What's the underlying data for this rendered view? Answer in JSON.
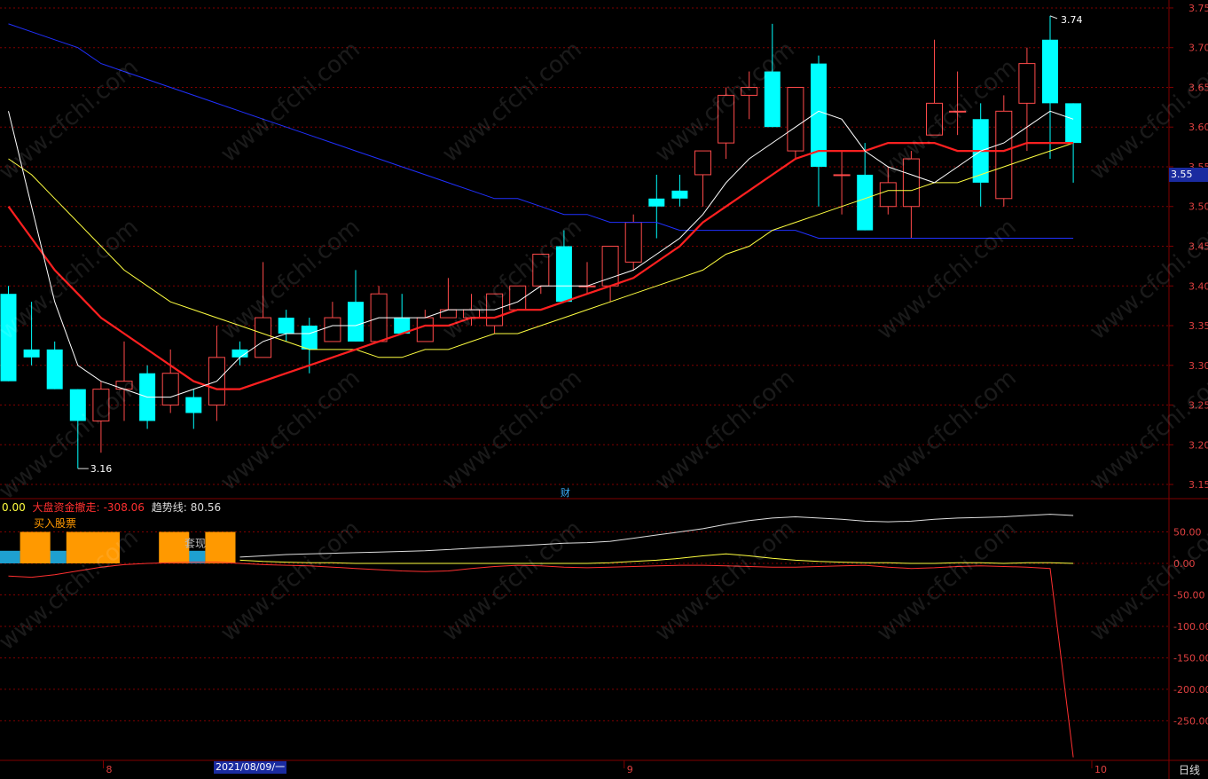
{
  "colors": {
    "up": "#ff4a4a",
    "down": "#00ffff",
    "ma5": "#ffffff",
    "ma10": "#ff2020",
    "ma20": "#ffff40",
    "ma60": "#2030ff",
    "grid": "#800000",
    "axis_text": "#e04040",
    "buy": "#ff9900",
    "cash": "#1ea0d0"
  },
  "legend": {
    "value0": "0.00",
    "main_label": "大盘资金撤走:",
    "main_value": "-308.06",
    "trend_label": "趋势线:",
    "trend_value": "80.56",
    "buy_label": "买入股票",
    "cash_label": "套现",
    "fin_marker": "财"
  },
  "current_price": "3.55",
  "cursor_date": "2021/08/09/一",
  "period_label": "日线",
  "watermark": "www.cfchi.com",
  "chart_data": [
    {
      "type": "candlestick",
      "ylim": [
        3.14,
        3.76
      ],
      "yticks": [
        "3.15",
        "3.20",
        "3.25",
        "3.30",
        "3.35",
        "3.40",
        "3.45",
        "3.50",
        "3.55",
        "3.60",
        "3.65",
        "3.70",
        "3.75"
      ],
      "x_labels": [
        "8",
        "9",
        "10"
      ],
      "x_label_index": [
        4.1,
        26.6,
        46.8
      ],
      "annotations": {
        "high": "3.74",
        "low": "3.16"
      },
      "candles": [
        [
          3.39,
          3.4,
          3.28,
          3.28
        ],
        [
          3.32,
          3.38,
          3.3,
          3.31
        ],
        [
          3.32,
          3.33,
          3.27,
          3.27
        ],
        [
          3.27,
          3.27,
          3.17,
          3.23
        ],
        [
          3.23,
          3.28,
          3.19,
          3.27
        ],
        [
          3.27,
          3.33,
          3.23,
          3.28
        ],
        [
          3.29,
          3.3,
          3.22,
          3.23
        ],
        [
          3.25,
          3.32,
          3.24,
          3.29
        ],
        [
          3.26,
          3.27,
          3.22,
          3.24
        ],
        [
          3.25,
          3.35,
          3.23,
          3.31
        ],
        [
          3.32,
          3.33,
          3.3,
          3.31
        ],
        [
          3.31,
          3.43,
          3.31,
          3.36
        ],
        [
          3.36,
          3.37,
          3.33,
          3.34
        ],
        [
          3.35,
          3.36,
          3.29,
          3.32
        ],
        [
          3.33,
          3.38,
          3.33,
          3.36
        ],
        [
          3.38,
          3.42,
          3.33,
          3.33
        ],
        [
          3.33,
          3.4,
          3.33,
          3.39
        ],
        [
          3.36,
          3.39,
          3.34,
          3.34
        ],
        [
          3.33,
          3.37,
          3.33,
          3.36
        ],
        [
          3.36,
          3.41,
          3.36,
          3.37
        ],
        [
          3.36,
          3.39,
          3.35,
          3.37
        ],
        [
          3.35,
          3.39,
          3.34,
          3.39
        ],
        [
          3.37,
          3.4,
          3.37,
          3.4
        ],
        [
          3.4,
          3.44,
          3.39,
          3.44
        ],
        [
          3.45,
          3.47,
          3.38,
          3.38
        ],
        [
          3.4,
          3.43,
          3.39,
          3.4
        ],
        [
          3.4,
          3.45,
          3.38,
          3.45
        ],
        [
          3.43,
          3.49,
          3.42,
          3.48
        ],
        [
          3.51,
          3.54,
          3.46,
          3.5
        ],
        [
          3.52,
          3.54,
          3.5,
          3.51
        ],
        [
          3.54,
          3.57,
          3.5,
          3.57
        ],
        [
          3.58,
          3.65,
          3.56,
          3.64
        ],
        [
          3.64,
          3.67,
          3.61,
          3.65
        ],
        [
          3.67,
          3.73,
          3.6,
          3.6
        ],
        [
          3.57,
          3.65,
          3.56,
          3.65
        ],
        [
          3.68,
          3.69,
          3.5,
          3.55
        ],
        [
          3.54,
          3.57,
          3.49,
          3.54
        ],
        [
          3.54,
          3.58,
          3.47,
          3.47
        ],
        [
          3.5,
          3.55,
          3.49,
          3.53
        ],
        [
          3.5,
          3.57,
          3.46,
          3.56
        ],
        [
          3.59,
          3.71,
          3.59,
          3.63
        ],
        [
          3.62,
          3.67,
          3.59,
          3.62
        ],
        [
          3.61,
          3.63,
          3.5,
          3.53
        ],
        [
          3.51,
          3.64,
          3.5,
          3.62
        ],
        [
          3.63,
          3.7,
          3.57,
          3.68
        ],
        [
          3.71,
          3.74,
          3.56,
          3.63
        ],
        [
          3.63,
          3.63,
          3.53,
          3.58
        ]
      ],
      "ma5": [
        3.62,
        3.5,
        3.38,
        3.3,
        3.28,
        3.27,
        3.26,
        3.26,
        3.27,
        3.28,
        3.31,
        3.33,
        3.34,
        3.34,
        3.35,
        3.35,
        3.36,
        3.36,
        3.36,
        3.37,
        3.37,
        3.37,
        3.38,
        3.4,
        3.4,
        3.4,
        3.41,
        3.42,
        3.44,
        3.46,
        3.49,
        3.53,
        3.56,
        3.58,
        3.6,
        3.62,
        3.61,
        3.57,
        3.55,
        3.54,
        3.53,
        3.55,
        3.57,
        3.58,
        3.6,
        3.62,
        3.61
      ],
      "ma10": [
        3.5,
        3.46,
        3.42,
        3.39,
        3.36,
        3.34,
        3.32,
        3.3,
        3.28,
        3.27,
        3.27,
        3.28,
        3.29,
        3.3,
        3.31,
        3.32,
        3.33,
        3.34,
        3.35,
        3.35,
        3.36,
        3.36,
        3.37,
        3.37,
        3.38,
        3.39,
        3.4,
        3.41,
        3.43,
        3.45,
        3.48,
        3.5,
        3.52,
        3.54,
        3.56,
        3.57,
        3.57,
        3.57,
        3.58,
        3.58,
        3.58,
        3.57,
        3.57,
        3.57,
        3.58,
        3.58,
        3.58
      ],
      "ma20": [
        3.56,
        3.54,
        3.51,
        3.48,
        3.45,
        3.42,
        3.4,
        3.38,
        3.37,
        3.36,
        3.35,
        3.34,
        3.33,
        3.32,
        3.32,
        3.32,
        3.31,
        3.31,
        3.32,
        3.32,
        3.33,
        3.34,
        3.34,
        3.35,
        3.36,
        3.37,
        3.38,
        3.39,
        3.4,
        3.41,
        3.42,
        3.44,
        3.45,
        3.47,
        3.48,
        3.49,
        3.5,
        3.51,
        3.52,
        3.52,
        3.53,
        3.53,
        3.54,
        3.55,
        3.56,
        3.57,
        3.58
      ],
      "ma60": [
        3.73,
        3.72,
        3.71,
        3.7,
        3.68,
        3.67,
        3.66,
        3.65,
        3.64,
        3.63,
        3.62,
        3.61,
        3.6,
        3.59,
        3.58,
        3.57,
        3.56,
        3.55,
        3.54,
        3.53,
        3.52,
        3.51,
        3.51,
        3.5,
        3.49,
        3.49,
        3.48,
        3.48,
        3.48,
        3.47,
        3.47,
        3.47,
        3.47,
        3.47,
        3.47,
        3.46,
        3.46,
        3.46,
        3.46,
        3.46,
        3.46,
        3.46,
        3.46,
        3.46,
        3.46,
        3.46,
        3.46
      ]
    },
    {
      "type": "line",
      "ylim": [
        -310,
        100
      ],
      "yticks": [
        "50.00",
        "0.00",
        "-50.00",
        "-100.00",
        "-150.00",
        "-200.00",
        "-250.00"
      ],
      "ytick_values": [
        50,
        0,
        -50,
        -100,
        -150,
        -200,
        -250
      ],
      "series": [
        {
          "name": "趋势线",
          "color": "#dddddd",
          "values": [
            null,
            null,
            null,
            null,
            null,
            null,
            null,
            null,
            null,
            null,
            10,
            12,
            14,
            15,
            16,
            17,
            18,
            19,
            20,
            22,
            24,
            26,
            28,
            30,
            32,
            33,
            35,
            40,
            45,
            50,
            55,
            62,
            68,
            72,
            74,
            72,
            70,
            67,
            66,
            67,
            70,
            72,
            73,
            74,
            76,
            78,
            76
          ]
        },
        {
          "name": "trend2",
          "color": "#ffff40",
          "values": [
            null,
            null,
            null,
            null,
            null,
            null,
            null,
            null,
            null,
            null,
            5,
            3,
            2,
            1,
            1,
            0,
            0,
            0,
            0,
            0,
            0,
            0,
            0,
            0,
            0,
            0,
            1,
            3,
            5,
            8,
            12,
            15,
            12,
            8,
            5,
            3,
            2,
            1,
            1,
            0,
            0,
            1,
            1,
            0,
            1,
            1,
            0
          ]
        },
        {
          "name": "大盘资金撤走",
          "color": "#ff3030",
          "values": [
            -20,
            -22,
            -18,
            -12,
            -6,
            -2,
            0,
            1,
            2,
            2,
            0,
            -2,
            -3,
            -4,
            -6,
            -8,
            -10,
            -12,
            -13,
            -12,
            -8,
            -5,
            -3,
            -4,
            -6,
            -7,
            -6,
            -5,
            -4,
            -3,
            -3,
            -4,
            -5,
            -6,
            -6,
            -5,
            -4,
            -3,
            -6,
            -8,
            -7,
            -5,
            -4,
            -5,
            -6,
            -8,
            -308
          ]
        }
      ],
      "bars": {
        "buy_index": [
          1,
          3,
          4,
          7,
          9
        ],
        "cash_index": [
          0,
          2,
          8
        ]
      }
    }
  ]
}
